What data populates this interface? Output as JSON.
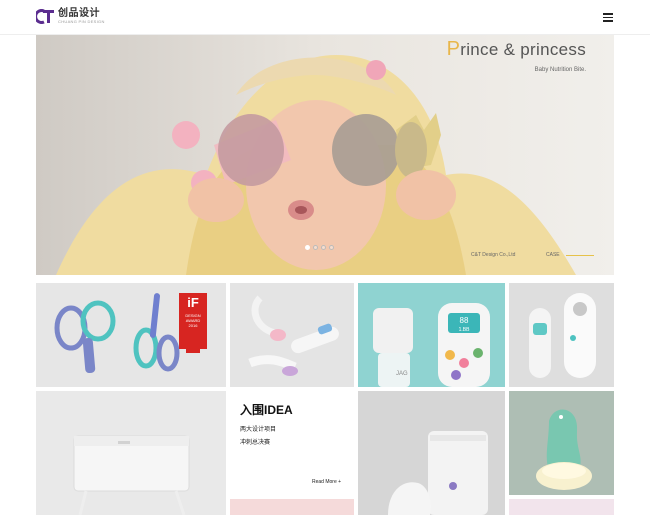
{
  "header": {
    "logo_cn": "创品设计",
    "logo_en": "CHUANG PIN DESIGN",
    "logo_icon": "ct-logo-icon",
    "menu_icon": "hamburger-menu-icon"
  },
  "hero": {
    "title_first": "P",
    "title_rest": "rince & princess",
    "subtitle": "Baby Nutrition Bite.",
    "footer_company": "C&T Design Co.,Ltd",
    "footer_case": "CASE",
    "slides_count": 4,
    "active_slide": 1
  },
  "tiles": {
    "idea": {
      "title": "入围IDEA",
      "line1": "两大设计项目",
      "line2": "冲刺总决赛",
      "read_more": "Read More +"
    },
    "if_award": {
      "logo": "iF",
      "line1": "DESIGN",
      "line2": "AWARD",
      "line3": "2016"
    },
    "bottle_display": {
      "top": "88",
      "bottom": "1.BB"
    },
    "bottle_label": "JAG"
  },
  "colors": {
    "accent_yellow": "#e8b64a",
    "logo_purple": "#5b2d8f",
    "if_red": "#d72521",
    "teal_tile": "#8fd3d1"
  }
}
